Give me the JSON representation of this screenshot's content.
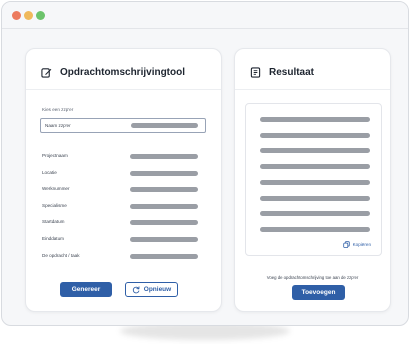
{
  "window": {
    "controls": [
      "close",
      "minimize",
      "maximize"
    ]
  },
  "left_panel": {
    "title": "Opdrachtomschrijvingtool",
    "icon": "edit-icon",
    "hint": "Kies een zzp'er",
    "name_field_label": "Naam zzp'er",
    "fields": [
      {
        "label": "Projectnaam"
      },
      {
        "label": "Locatie"
      },
      {
        "label": "Werknummer"
      },
      {
        "label": "Specialisme"
      },
      {
        "label": "Startdatum"
      },
      {
        "label": "Einddatum"
      },
      {
        "label": "De opdracht / taak"
      }
    ],
    "generate_label": "Genereer",
    "retry_label": "Opnieuw",
    "retry_icon": "refresh-icon"
  },
  "right_panel": {
    "title": "Resultaat",
    "icon": "document-icon",
    "result_lines": 8,
    "copy_label": "Kopiëren",
    "copy_icon": "copy-icon",
    "add_hint": "Voeg de opdrachtomschrijving toe aan de zzp'er",
    "add_label": "Toevoegen"
  },
  "colors": {
    "accent": "#2f5fa7",
    "placeholder_bar": "#9a9ea5",
    "window_dot_red": "#ec7a5e",
    "window_dot_yellow": "#f0b95b",
    "window_dot_green": "#6cc36b"
  }
}
